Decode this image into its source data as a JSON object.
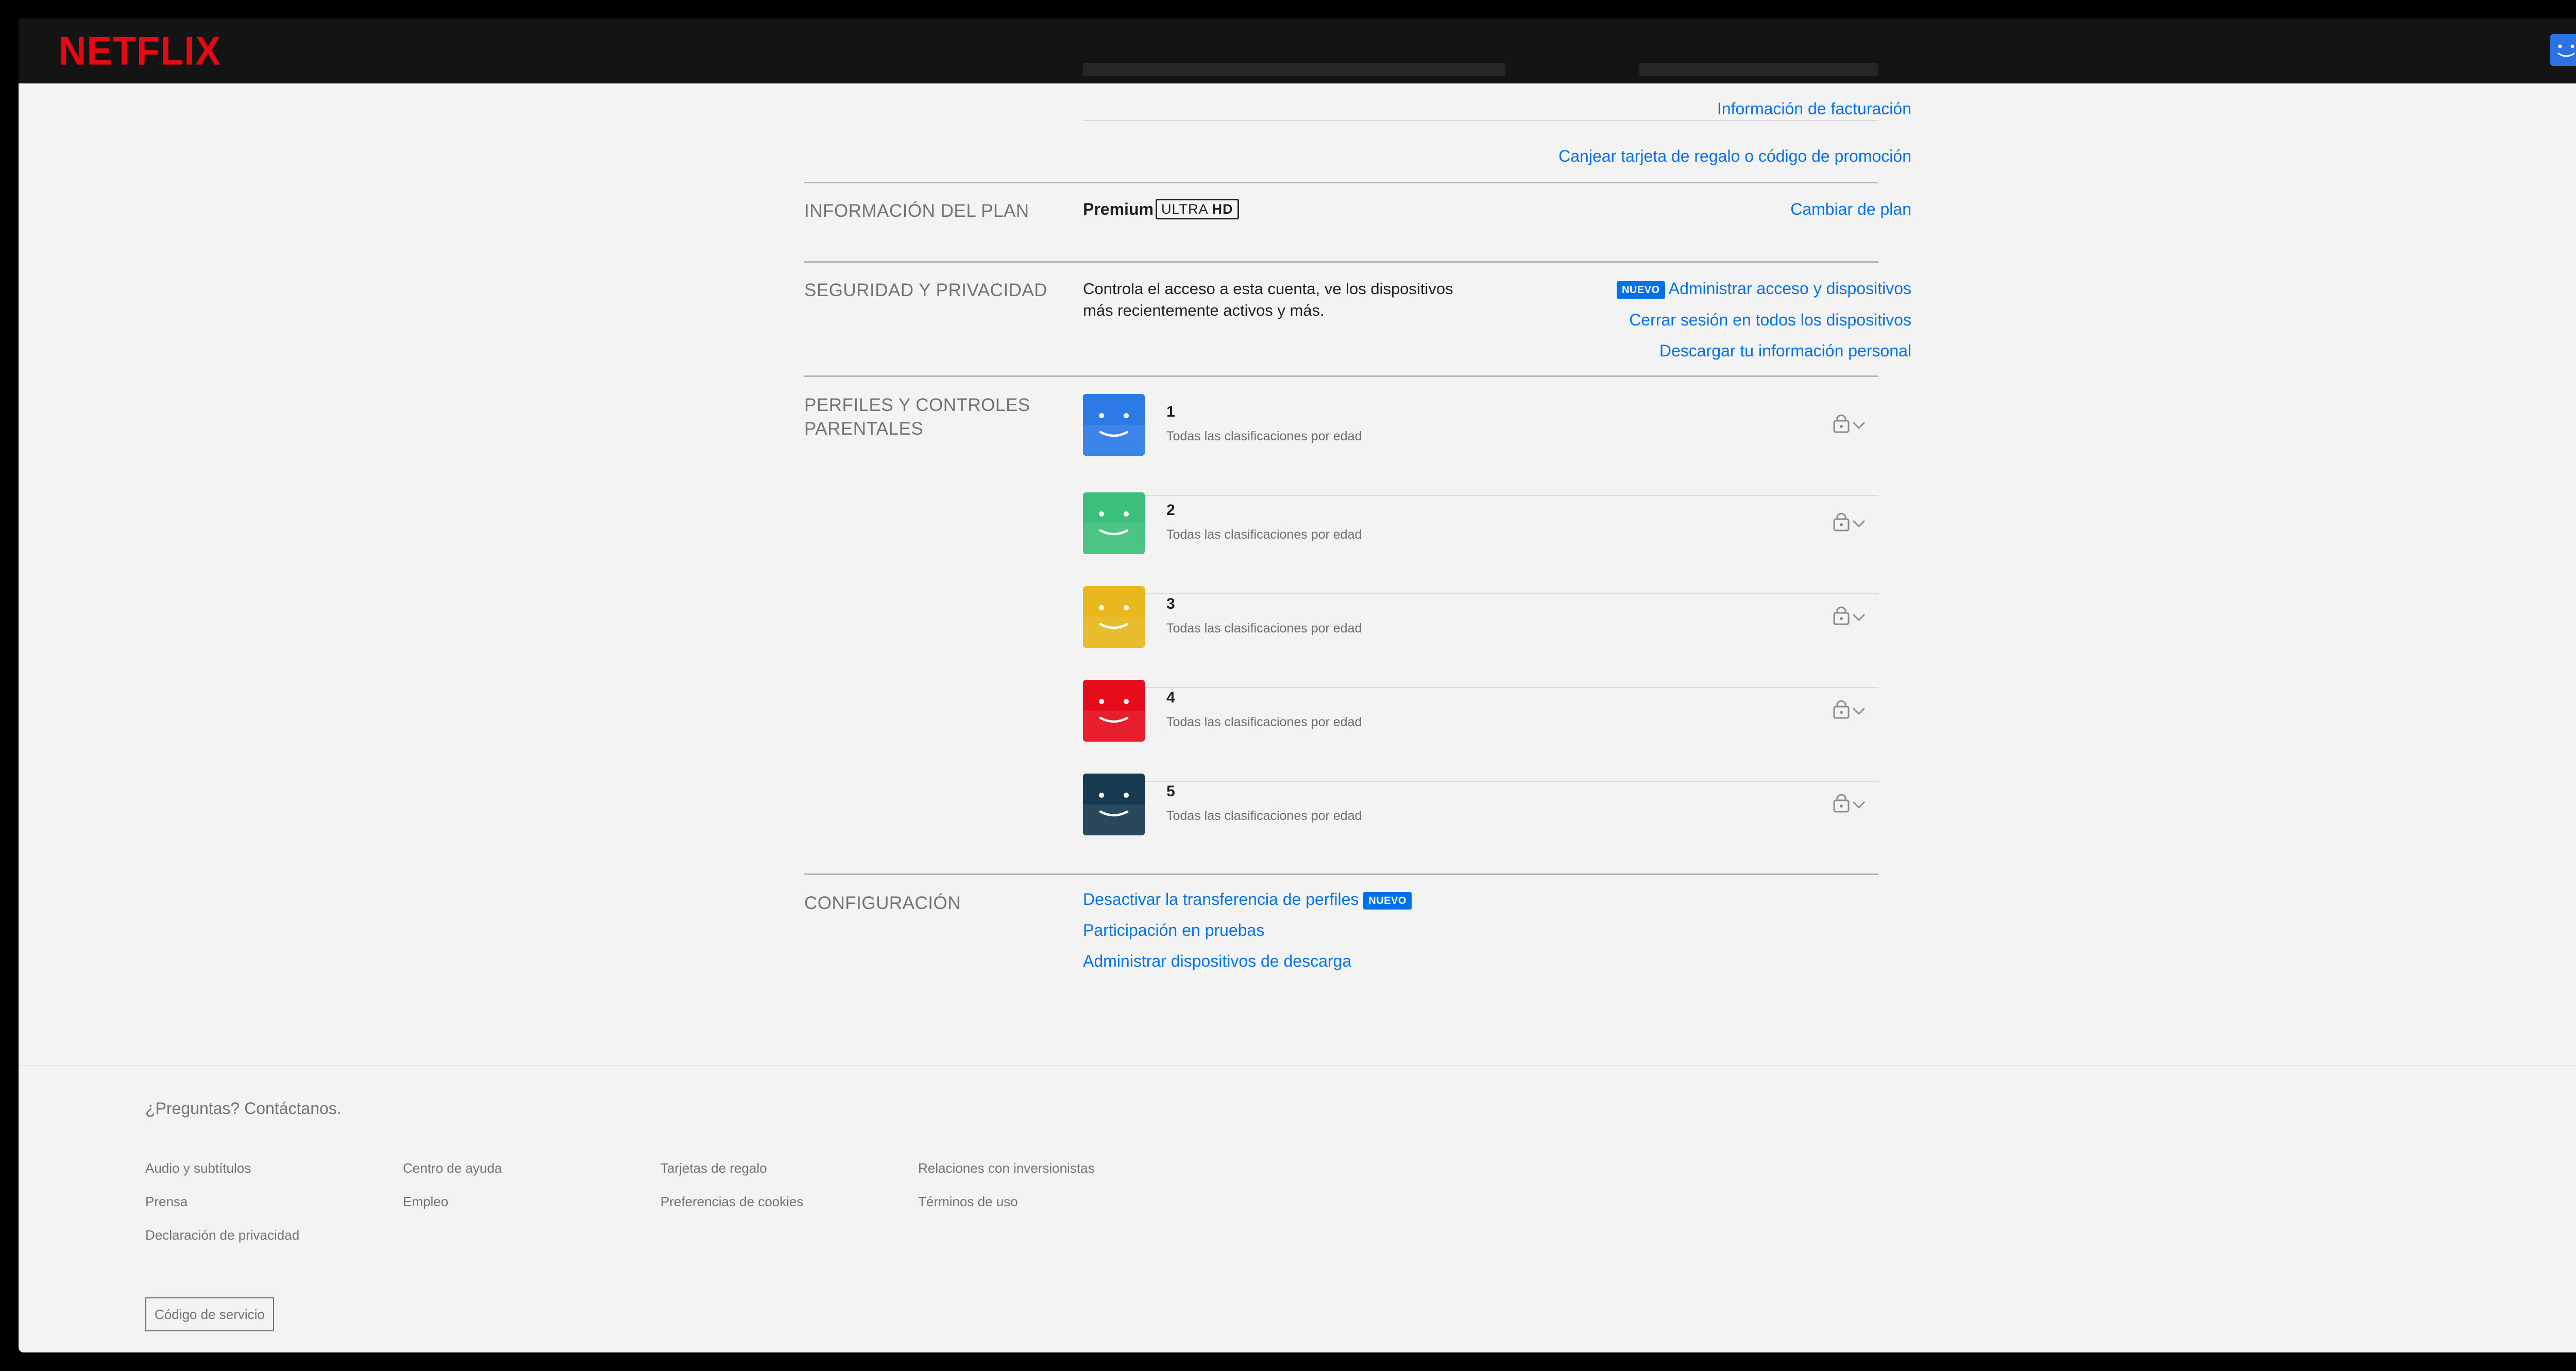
{
  "header": {
    "logo_text": "NETFLIX",
    "avatar_color": "#2b73e5"
  },
  "billing": {
    "billing_info_link": "Información de facturación",
    "gift_link": "Canjear tarjeta de regalo o código de promoción"
  },
  "plan": {
    "title": "INFORMACIÓN DEL PLAN",
    "plan_name": "Premium",
    "badge_ultra": "ULTRA",
    "badge_hd": "HD",
    "change_link": "Cambiar de plan"
  },
  "security": {
    "title": "SEGURIDAD Y PRIVACIDAD",
    "description_line1": "Controla el acceso a esta cuenta, ve los dispositivos",
    "description_line2": "más recientemente activos y más.",
    "new_badge": "NUEVO",
    "manage_link": "Administrar acceso y dispositivos",
    "signout_link": "Cerrar sesión en todos los dispositivos",
    "download_link": "Descargar tu información personal"
  },
  "profiles": {
    "title_line1": "PERFILES Y CONTROLES",
    "title_line2": "PARENTALES",
    "items": [
      {
        "name": "1",
        "subtitle": "Todas las clasificaciones por edad",
        "color": "#2c7ae5"
      },
      {
        "name": "2",
        "subtitle": "Todas las clasificaciones por edad",
        "color": "#3cbf7a"
      },
      {
        "name": "3",
        "subtitle": "Todas las clasificaciones por edad",
        "color": "#e8b81c"
      },
      {
        "name": "4",
        "subtitle": "Todas las clasificaciones por edad",
        "color": "#e50c1c"
      },
      {
        "name": "5",
        "subtitle": "Todas las clasificaciones por edad",
        "color": "#163a4f"
      }
    ]
  },
  "settings": {
    "title": "CONFIGURACIÓN",
    "transfer_link": "Desactivar la transferencia de perfiles",
    "new_badge": "NUEVO",
    "test_link": "Participación en pruebas",
    "download_devices_link": "Administrar dispositivos de descarga"
  },
  "footer": {
    "question": "¿Preguntas? Contáctanos.",
    "links": [
      "Audio y subtítulos",
      "Centro de ayuda",
      "Tarjetas de regalo",
      "Relaciones con inversionistas",
      "Prensa",
      "Empleo",
      "Preferencias de cookies",
      "Términos de uso",
      "Declaración de privacidad"
    ],
    "service_code": "Código de servicio"
  }
}
